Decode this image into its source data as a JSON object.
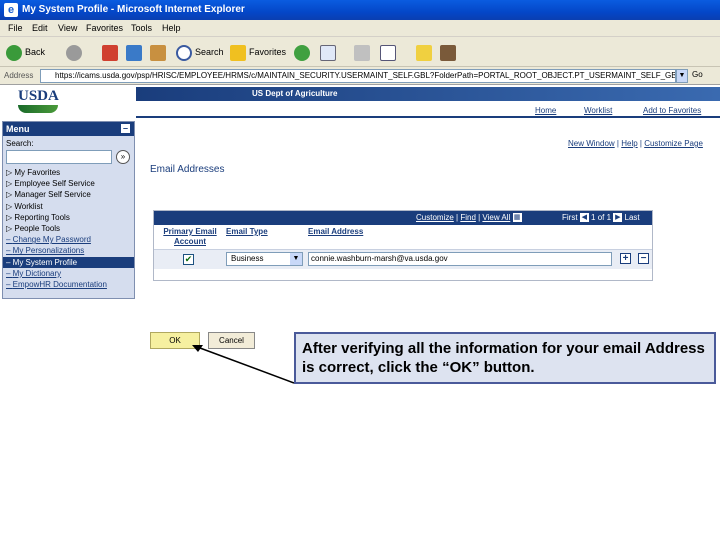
{
  "window": {
    "title": "My System Profile - Microsoft Internet Explorer"
  },
  "menubar": [
    "File",
    "Edit",
    "View",
    "Favorites",
    "Tools",
    "Help"
  ],
  "toolbar": {
    "back": "Back",
    "search": "Search",
    "favorites": "Favorites"
  },
  "address": {
    "label": "Address",
    "url": "https://icams.usda.gov/psp/HRISC/EMPLOYEE/HRMS/c/MAINTAIN_SECURITY.USERMAINT_SELF.GBL?FolderPath=PORTAL_ROOT_OBJECT.PT_USERMAINT_SELF_GBL&IsF",
    "go": "Go"
  },
  "header": {
    "logo": "USDA",
    "agency": "US Dept of Agriculture",
    "links": [
      "Home",
      "Worklist",
      "Add to Favorites"
    ]
  },
  "menu": {
    "title": "Menu",
    "search_label": "Search:",
    "items": [
      {
        "label": "My Favorites",
        "type": "folder"
      },
      {
        "label": "Employee Self Service",
        "type": "folder"
      },
      {
        "label": "Manager Self Service",
        "type": "folder"
      },
      {
        "label": "Worklist",
        "type": "folder"
      },
      {
        "label": "Reporting Tools",
        "type": "folder"
      },
      {
        "label": "People Tools",
        "type": "folder"
      },
      {
        "label": "Change My Password",
        "type": "link"
      },
      {
        "label": "My Personalizations",
        "type": "link"
      },
      {
        "label": "My System Profile",
        "type": "selected"
      },
      {
        "label": "My Dictionary",
        "type": "link"
      },
      {
        "label": "EmpowHR Documentation",
        "type": "link"
      }
    ]
  },
  "page": {
    "links": [
      "New Window",
      "Help",
      "Customize Page"
    ],
    "title": "Email Addresses",
    "grid": {
      "customize": "Customize",
      "find": "Find",
      "view_all": "View All",
      "first": "First",
      "range": "1 of 1",
      "last": "Last",
      "headers": {
        "primary": "Primary Email Account",
        "type": "Email Type",
        "address": "Email Address"
      },
      "rows": [
        {
          "primary": true,
          "type": "Business",
          "address": "connie.washburn-marsh@va.usda.gov"
        }
      ]
    },
    "buttons": {
      "ok": "OK",
      "cancel": "Cancel"
    }
  },
  "callout": "After verifying all the information for your email Address is correct, click the “OK” button."
}
